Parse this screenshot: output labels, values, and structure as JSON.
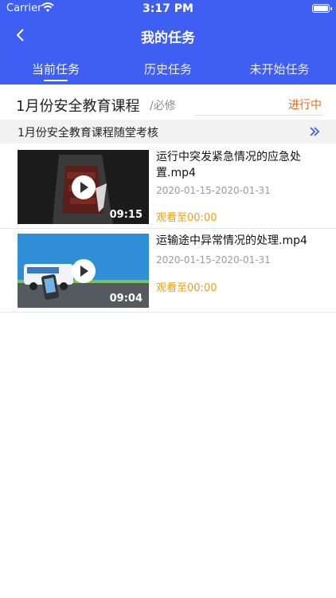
{
  "status_bar": {
    "carrier": "Carrier",
    "time": "3:17 PM"
  },
  "header": {
    "title": "我的任务"
  },
  "tabs": [
    {
      "label": "当前任务"
    },
    {
      "label": "历史任务"
    },
    {
      "label": "未开始任务"
    }
  ],
  "course": {
    "name": "1月份安全教育课程",
    "type": "/必修",
    "status": "进行中"
  },
  "assessment": {
    "label": "1月份安全教育课程随堂考核"
  },
  "videos": [
    {
      "title": "运行中突发紧急情况的应急处置.mp4",
      "dates": "2020-01-15-2020-01-31",
      "watch": "观看至00:00",
      "duration": "09:15"
    },
    {
      "title": "运输途中异常情况的处理.mp4",
      "dates": "2020-01-15-2020-01-31",
      "watch": "观看至00:00",
      "duration": "09:04"
    }
  ],
  "colors": {
    "accent": "#3f5ef2",
    "status_orange": "#ee6b1c",
    "watch_yellow": "#e9a21c"
  }
}
